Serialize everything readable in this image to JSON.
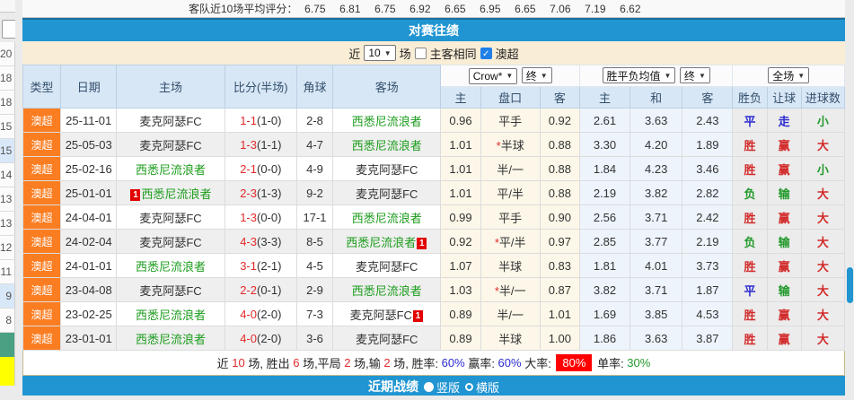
{
  "top_ratings": {
    "label": "客队近10场平均评分：",
    "values": [
      "6.75",
      "6.81",
      "6.75",
      "6.92",
      "6.65",
      "6.95",
      "6.65",
      "7.06",
      "7.19",
      "6.62"
    ]
  },
  "left_strip": {
    "numbers": [
      "20",
      "18",
      "18",
      "15",
      "15",
      "14",
      "13",
      "13",
      "12",
      "11",
      "9",
      "8"
    ],
    "highlighted_indexes": [
      4,
      10
    ]
  },
  "section_title": "对赛往绩",
  "filter": {
    "near_label": "近",
    "count_value": "10",
    "games_label": "场",
    "same_venue_label": "主客相同",
    "league_label": "澳超",
    "same_venue_checked": false,
    "league_checked": true
  },
  "table": {
    "dropdowns": {
      "bookmaker": "Crow*",
      "final_a": "终",
      "wdl_mean": "胜平负均值",
      "final_b": "终",
      "full_match": "全场"
    },
    "col_headers": [
      "类型",
      "日期",
      "主场",
      "比分(半场)",
      "角球",
      "客场",
      "主",
      "盘口",
      "客",
      "主",
      "和",
      "客",
      "胜负",
      "让球",
      "进球数"
    ],
    "rows": [
      {
        "league": "澳超",
        "date": "25-11-01",
        "home": "麦克阿瑟FC",
        "home_green": false,
        "home_badge": false,
        "score": "1-1",
        "half": "(1-0)",
        "corner": "2-8",
        "away": "西悉尼流浪者",
        "away_green": true,
        "away_badge": false,
        "h_home": "0.96",
        "star": false,
        "handicap": "平手",
        "h_away": "0.92",
        "o_home": "2.61",
        "o_draw": "3.63",
        "o_away": "2.43",
        "r_wdl": "平",
        "r_wdl_c": "blue",
        "r_hcap": "走",
        "r_hcap_c": "blue",
        "r_goal": "小",
        "r_goal_c": "green"
      },
      {
        "league": "澳超",
        "date": "25-05-03",
        "home": "麦克阿瑟FC",
        "home_green": false,
        "home_badge": false,
        "score": "1-3",
        "half": "(1-1)",
        "corner": "4-7",
        "away": "西悉尼流浪者",
        "away_green": true,
        "away_badge": false,
        "h_home": "1.01",
        "star": true,
        "handicap": "半球",
        "h_away": "0.88",
        "o_home": "3.30",
        "o_draw": "4.20",
        "o_away": "1.89",
        "r_wdl": "胜",
        "r_wdl_c": "red",
        "r_hcap": "赢",
        "r_hcap_c": "red",
        "r_goal": "大",
        "r_goal_c": "red"
      },
      {
        "league": "澳超",
        "date": "25-02-16",
        "home": "西悉尼流浪者",
        "home_green": true,
        "home_badge": false,
        "score": "2-1",
        "half": "(0-0)",
        "corner": "4-9",
        "away": "麦克阿瑟FC",
        "away_green": false,
        "away_badge": false,
        "h_home": "1.01",
        "star": false,
        "handicap": "半/一",
        "h_away": "0.88",
        "o_home": "1.84",
        "o_draw": "4.23",
        "o_away": "3.46",
        "r_wdl": "胜",
        "r_wdl_c": "red",
        "r_hcap": "赢",
        "r_hcap_c": "red",
        "r_goal": "小",
        "r_goal_c": "green"
      },
      {
        "league": "澳超",
        "date": "25-01-01",
        "home": "西悉尼流浪者",
        "home_green": true,
        "home_badge": true,
        "score": "2-3",
        "half": "(1-3)",
        "corner": "9-2",
        "away": "麦克阿瑟FC",
        "away_green": false,
        "away_badge": false,
        "h_home": "1.01",
        "star": false,
        "handicap": "平/半",
        "h_away": "0.88",
        "o_home": "2.19",
        "o_draw": "3.82",
        "o_away": "2.82",
        "r_wdl": "负",
        "r_wdl_c": "green",
        "r_hcap": "输",
        "r_hcap_c": "green",
        "r_goal": "大",
        "r_goal_c": "red"
      },
      {
        "league": "澳超",
        "date": "24-04-01",
        "home": "麦克阿瑟FC",
        "home_green": false,
        "home_badge": false,
        "score": "1-3",
        "half": "(0-0)",
        "corner": "17-1",
        "away": "西悉尼流浪者",
        "away_green": true,
        "away_badge": false,
        "h_home": "0.99",
        "star": false,
        "handicap": "平手",
        "h_away": "0.90",
        "o_home": "2.56",
        "o_draw": "3.71",
        "o_away": "2.42",
        "r_wdl": "胜",
        "r_wdl_c": "red",
        "r_hcap": "赢",
        "r_hcap_c": "red",
        "r_goal": "大",
        "r_goal_c": "red"
      },
      {
        "league": "澳超",
        "date": "24-02-04",
        "home": "麦克阿瑟FC",
        "home_green": false,
        "home_badge": false,
        "score": "4-3",
        "half": "(3-3)",
        "corner": "8-5",
        "away": "西悉尼流浪者",
        "away_green": true,
        "away_badge": true,
        "h_home": "0.92",
        "star": true,
        "handicap": "平/半",
        "h_away": "0.97",
        "o_home": "2.85",
        "o_draw": "3.77",
        "o_away": "2.19",
        "r_wdl": "负",
        "r_wdl_c": "green",
        "r_hcap": "输",
        "r_hcap_c": "green",
        "r_goal": "大",
        "r_goal_c": "red"
      },
      {
        "league": "澳超",
        "date": "24-01-01",
        "home": "西悉尼流浪者",
        "home_green": true,
        "home_badge": false,
        "score": "3-1",
        "half": "(2-1)",
        "corner": "4-5",
        "away": "麦克阿瑟FC",
        "away_green": false,
        "away_badge": false,
        "h_home": "1.07",
        "star": false,
        "handicap": "半球",
        "h_away": "0.83",
        "o_home": "1.81",
        "o_draw": "4.01",
        "o_away": "3.73",
        "r_wdl": "胜",
        "r_wdl_c": "red",
        "r_hcap": "赢",
        "r_hcap_c": "red",
        "r_goal": "大",
        "r_goal_c": "red"
      },
      {
        "league": "澳超",
        "date": "23-04-08",
        "home": "麦克阿瑟FC",
        "home_green": false,
        "home_badge": false,
        "score": "2-2",
        "half": "(0-1)",
        "corner": "2-9",
        "away": "西悉尼流浪者",
        "away_green": true,
        "away_badge": false,
        "h_home": "1.03",
        "star": true,
        "handicap": "半/一",
        "h_away": "0.87",
        "o_home": "3.82",
        "o_draw": "3.71",
        "o_away": "1.87",
        "r_wdl": "平",
        "r_wdl_c": "blue",
        "r_hcap": "输",
        "r_hcap_c": "green",
        "r_goal": "大",
        "r_goal_c": "red"
      },
      {
        "league": "澳超",
        "date": "23-02-25",
        "home": "西悉尼流浪者",
        "home_green": true,
        "home_badge": false,
        "score": "4-0",
        "half": "(2-0)",
        "corner": "7-3",
        "away": "麦克阿瑟FC",
        "away_green": false,
        "away_badge": true,
        "h_home": "0.89",
        "star": false,
        "handicap": "半/一",
        "h_away": "1.01",
        "o_home": "1.69",
        "o_draw": "3.85",
        "o_away": "4.53",
        "r_wdl": "胜",
        "r_wdl_c": "red",
        "r_hcap": "赢",
        "r_hcap_c": "red",
        "r_goal": "大",
        "r_goal_c": "red"
      },
      {
        "league": "澳超",
        "date": "23-01-01",
        "home": "西悉尼流浪者",
        "home_green": true,
        "home_badge": false,
        "score": "4-0",
        "half": "(2-0)",
        "corner": "3-6",
        "away": "麦克阿瑟FC",
        "away_green": false,
        "away_badge": false,
        "h_home": "0.89",
        "star": false,
        "handicap": "半球",
        "h_away": "1.00",
        "o_home": "1.86",
        "o_draw": "3.63",
        "o_away": "3.87",
        "r_wdl": "胜",
        "r_wdl_c": "red",
        "r_hcap": "赢",
        "r_hcap_c": "red",
        "r_goal": "大",
        "r_goal_c": "red"
      }
    ]
  },
  "summary": {
    "segments": [
      {
        "text": "近 ",
        "color": "k"
      },
      {
        "text": "10",
        "color": "red"
      },
      {
        "text": " 场, 胜出 ",
        "color": "k"
      },
      {
        "text": "6",
        "color": "red"
      },
      {
        "text": " 场,平局 ",
        "color": "k"
      },
      {
        "text": "2",
        "color": "red"
      },
      {
        "text": " 场,输 ",
        "color": "k"
      },
      {
        "text": "2",
        "color": "red"
      },
      {
        "text": " 场, 胜率: ",
        "color": "k"
      },
      {
        "text": "60%",
        "color": "blue"
      },
      {
        "text": " 赢率: ",
        "color": "k"
      },
      {
        "text": "60%",
        "color": "blue"
      },
      {
        "text": " 大率: ",
        "color": "k"
      },
      {
        "text": "80%",
        "color": "redbg"
      },
      {
        "text": " 单率: ",
        "color": "k"
      },
      {
        "text": "30%",
        "color": "green"
      }
    ]
  },
  "bottom_bar": {
    "title": "近期战绩",
    "option_vertical": "竖版",
    "option_horizontal": "横版",
    "selected": "竖版"
  },
  "colors": {
    "accent_blue": "#2095d2",
    "league_orange": "#fb7d21",
    "filter_cream": "#f9edd6",
    "header_blue": "#d8e7f6",
    "team_green": "#1c9c1c",
    "score_red": "#e22a2a",
    "result_red": "#d22a2a",
    "result_green": "#22992a",
    "result_blue": "#2b2bd0",
    "rate_badge_bg": "#ff0000"
  }
}
